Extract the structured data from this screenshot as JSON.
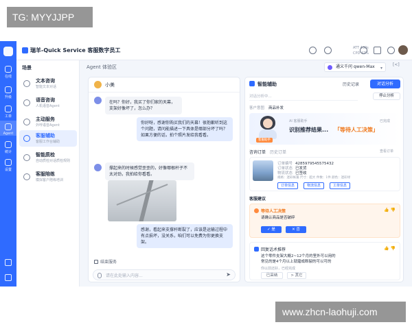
{
  "watermarks": {
    "top_left": "TG: MYYJJPP",
    "bottom_right": "www.zhcn-laohuji.com"
  },
  "rail": {
    "items": [
      {
        "label": "在线",
        "icon": "chat-icon"
      },
      {
        "label": "升级",
        "icon": "phone-icon"
      },
      {
        "label": "工单",
        "icon": "ticket-icon"
      },
      {
        "label": "Agent",
        "icon": "agent-icon"
      },
      {
        "label": "统计",
        "icon": "chart-icon"
      },
      {
        "label": "设置",
        "icon": "gear-icon"
      }
    ]
  },
  "topbar": {
    "brand": "瑞羊-Quick Service  客服数字员工",
    "stat_line1": "ATT 430s",
    "stat_line2": "CPD 47%"
  },
  "nav": {
    "heading": "场景",
    "items": [
      {
        "title": "文本咨询",
        "subtitle": "智能文本对话"
      },
      {
        "title": "语音咨询",
        "subtitle": "人机语音Agent"
      },
      {
        "title": "主动服务",
        "subtitle": "外呼语音Agent"
      },
      {
        "title": "客服辅助",
        "subtitle": "客服工作台辅助"
      },
      {
        "title": "智能质检",
        "subtitle": "自动质检对话质检规则"
      },
      {
        "title": "客服陪练",
        "subtitle": "模拟客户陪练培训"
      }
    ],
    "active_index": 3
  },
  "workspace": {
    "title": "Agent 体验区",
    "model": "通义千问 qwen-Max",
    "collapse": "[<]"
  },
  "chat": {
    "contact": "小美",
    "messages": [
      {
        "role": "customer",
        "text": "在吗？你好，我买了你们家的天幕，支架好像坏了，怎么办？"
      },
      {
        "role": "agent",
        "text": "你好呀，感谢你购买我们的天幕！很抱歉听到这个问题，请问能描述一下具体是哪部分坏了吗？如果方便的话，拍个照片发给我看看。"
      },
      {
        "role": "customer",
        "text": "撑起来的时候感觉歪歪的，好像哪根杆子不太对劲，我拍给你看看。"
      },
      {
        "role": "agent",
        "text": "感谢，看起来支撑杆断裂了，应该是运输过程中有点损坏，没关系，咱们可以免费为你更换支架。"
      }
    ],
    "end_service": "结束服务",
    "input_placeholder": "请在此处输入内容..."
  },
  "assistant": {
    "title": "智能辅助",
    "history": "历史记录",
    "primary_button": "对话分析",
    "input_placeholder": "对话分析中...",
    "stop_button": "停止分析",
    "intent_label": "客户意图",
    "intent_value": "商品补发",
    "hero": {
      "agent_tag": "客服助手",
      "subtitle": "AI 客服助手",
      "main": "识别推荐结果...",
      "highlight": "「等待人工决策」",
      "time_label": "已完成"
    },
    "order_section": {
      "tab_active": "咨询订单",
      "tab_inactive": "历史订单",
      "right_link": "查看订单",
      "order_no_label": "订单编号",
      "order_no": "4285979545575432",
      "status_label": "订单状态",
      "status": "已发货",
      "logistics_label": "物流状态",
      "logistics": "已签收",
      "meta": "规格：迷彩帐篷   尺寸：超大   件数：1件   颜色：迷彩绿",
      "buttons": [
        "订单信息",
        "物流信息",
        "工单信息"
      ]
    },
    "suggestion_heading": "客服建议",
    "warn_card": {
      "title": "等待人工决策",
      "body": "请确认商品是否破碎",
      "yes": "✓ 是",
      "no": "✕ 否"
    },
    "info_card": {
      "title": "回复话术推荐",
      "body_line1": "这个零件支架大概2~12个月的室外可以用的",
      "body_line2": "常见的是4个月以上就磨成断裂的可以可的",
      "note": "你以前还好，已经完成",
      "adopt": "已采纳",
      "other": "> 其它"
    },
    "thumbs": "👍 👎"
  }
}
